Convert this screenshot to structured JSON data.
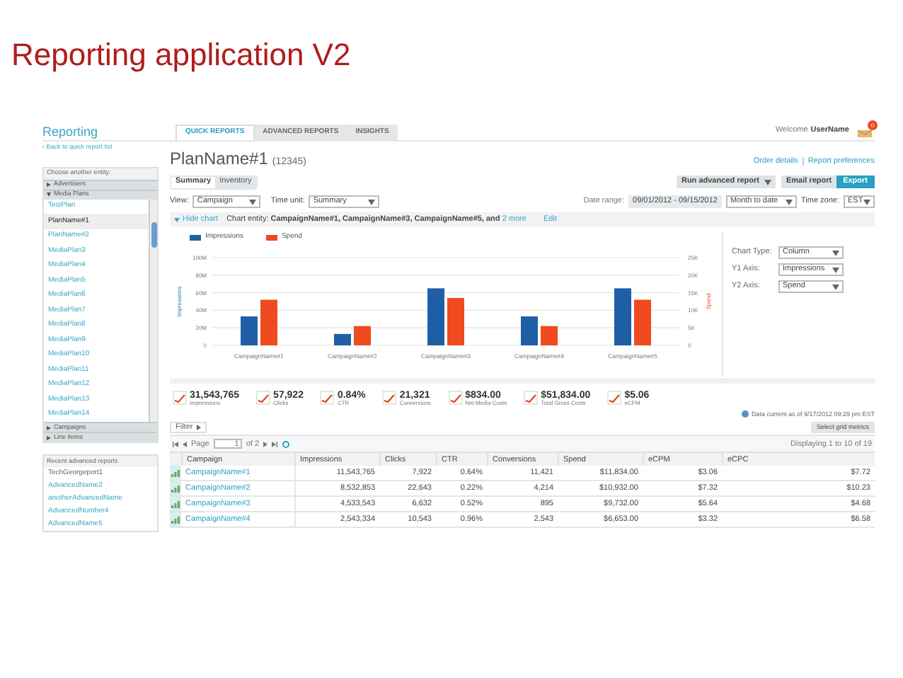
{
  "slide_title": "Reporting application V2",
  "app": {
    "title": "Reporting",
    "back_link": "‹ Back to quick report list",
    "welcome": "Welcome",
    "user": "UserName",
    "notification_count": "0"
  },
  "tabs": [
    {
      "label": "QUICK REPORTS",
      "selected": true
    },
    {
      "label": "ADVANCED REPORTS",
      "selected": false
    },
    {
      "label": "INSIGHTS",
      "selected": false
    }
  ],
  "sidebar": {
    "heading": "Choose another entity:",
    "sections": [
      {
        "label": "Advertisers",
        "expanded": false
      },
      {
        "label": "Media Plans",
        "expanded": true,
        "items": [
          {
            "label": "TestPlan",
            "selected": false
          },
          {
            "label": "PlanName#1",
            "selected": true
          },
          {
            "label": "PlanName#2",
            "selected": false
          },
          {
            "label": "MediaPlan3",
            "selected": false
          },
          {
            "label": "MediaPlan4",
            "selected": false
          },
          {
            "label": "MediaPlan5",
            "selected": false
          },
          {
            "label": "MediaPlan6",
            "selected": false
          },
          {
            "label": "MediaPlan7",
            "selected": false
          },
          {
            "label": "MediaPlan8",
            "selected": false
          },
          {
            "label": "MediaPlan9",
            "selected": false
          },
          {
            "label": "MediaPlan10",
            "selected": false
          },
          {
            "label": "MediaPlan11",
            "selected": false
          },
          {
            "label": "MediaPlan12",
            "selected": false
          },
          {
            "label": "MediaPlan13",
            "selected": false
          },
          {
            "label": "MediaPlan14",
            "selected": false
          }
        ]
      },
      {
        "label": "Campaigns",
        "expanded": false
      },
      {
        "label": "Line items",
        "expanded": false
      }
    ],
    "recent": {
      "heading": "Recent advanced reports",
      "items": [
        "TechGeorgeport1",
        "AdvancedName2",
        "anotherAdvancedName",
        "AdvancedNumber4",
        "AdvancedName5"
      ]
    }
  },
  "page": {
    "title": "PlanName#1",
    "id": "(12345)",
    "links": [
      "Order details",
      "Report preferences"
    ],
    "subtabs": [
      {
        "label": "Summary",
        "selected": true
      },
      {
        "label": "Inventory",
        "selected": false
      }
    ],
    "buttons": {
      "run": "Run advanced report",
      "email": "Email report",
      "export": "Export"
    },
    "view_label": "View:",
    "view": "Campaign",
    "time_unit_label": "Time unit:",
    "time_unit": "Summary",
    "date_range_label": "Date range:",
    "date_range": "09/01/2012 - 09/15/2012",
    "period": "Month to date",
    "time_zone_label": "Time zone:",
    "time_zone": "EST",
    "hide_chart": "Hide chart",
    "chart_entity": "Chart entity: **CampaignName#1, CampaignName#3, CampaignName#5, and** ",
    "more": "2 more",
    "edit": "Edit",
    "chart_data": {
      "type": "bar",
      "grid": true,
      "ylim": [
        0,
        100000000
      ],
      "y2lim": [
        0,
        25000
      ],
      "ylabel": "Impressions",
      "y2label": "Spend",
      "categories": [
        "CampaignName#1",
        "CampaignName#2",
        "CampaignName#3",
        "CampaignName#4",
        "CampaignName#5"
      ],
      "series": [
        {
          "name": "Impressions",
          "color": "#1f5fa6",
          "values": [
            33000000,
            13000000,
            65000000,
            33000000,
            65000000
          ]
        },
        {
          "name": "Spend",
          "color": "#f04a1f",
          "values": [
            13000,
            5500,
            13500,
            5500,
            13000
          ]
        }
      ],
      "yticks": [
        {
          "value": 0,
          "label": "0"
        },
        {
          "value": 20000000,
          "label": "20M"
        },
        {
          "value": 40000000,
          "label": "40M"
        },
        {
          "value": 60000000,
          "label": "60M"
        },
        {
          "value": 80000000,
          "label": "80M"
        },
        {
          "value": 100000000,
          "label": "100M"
        }
      ],
      "y2ticks": [
        {
          "value": 0,
          "label": "0"
        },
        {
          "value": 5000,
          "label": "5K"
        },
        {
          "value": 10000,
          "label": "10K"
        },
        {
          "value": 15000,
          "label": "15K"
        },
        {
          "value": 20000,
          "label": "20K"
        },
        {
          "value": 25000,
          "label": "25K"
        }
      ]
    },
    "chart_options": [
      {
        "label": "Chart Type:",
        "value": "Column"
      },
      {
        "label": "Y1 Axis:",
        "value": "Impressions"
      },
      {
        "label": "Y2 Axis:",
        "value": "Spend"
      }
    ],
    "kpis": [
      {
        "value": "31,543,765",
        "label": "Impressions"
      },
      {
        "value": "57,922",
        "label": "Clicks"
      },
      {
        "value": "0.84%",
        "label": "CTR"
      },
      {
        "value": "21,321",
        "label": "Conversions"
      },
      {
        "value": "$834.00",
        "label": "Net Media Costs"
      },
      {
        "value": "$51,834.00",
        "label": "Total Gross Costs"
      },
      {
        "value": "$5.06",
        "label": "eCPM"
      }
    ],
    "data_current": "Data current as of 9/17/2012 09:29 pm EST",
    "filter": "Filter",
    "grid_metrics": "Select grid metrics",
    "pager": {
      "page_label": "Page",
      "page": "1",
      "of": "of 2",
      "displaying": "Displaying 1 to 10 of 19"
    },
    "table": {
      "columns": [
        "Campaign",
        "Impressions",
        "Clicks",
        "CTR",
        "Conversions",
        "Spend",
        "eCPM",
        "eCPC"
      ],
      "rows": [
        [
          "CampaignName#1",
          "11,543,765",
          "7,922",
          "0.64%",
          "11,421",
          "$11,834.00",
          "$3.06",
          "$7.72"
        ],
        [
          "CampaignName#2",
          "8,532,853",
          "22,643",
          "0.22%",
          "4,214",
          "$10,932.00",
          "$7.32",
          "$10.23"
        ],
        [
          "CampaignName#3",
          "4,533,543",
          "6,632",
          "0.52%",
          "895",
          "$9,732.00",
          "$5.64",
          "$4.68"
        ],
        [
          "CampaignName#4",
          "2,543,334",
          "10,543",
          "0.96%",
          "2,543",
          "$6,653.00",
          "$3.32",
          "$6.58"
        ]
      ]
    }
  }
}
